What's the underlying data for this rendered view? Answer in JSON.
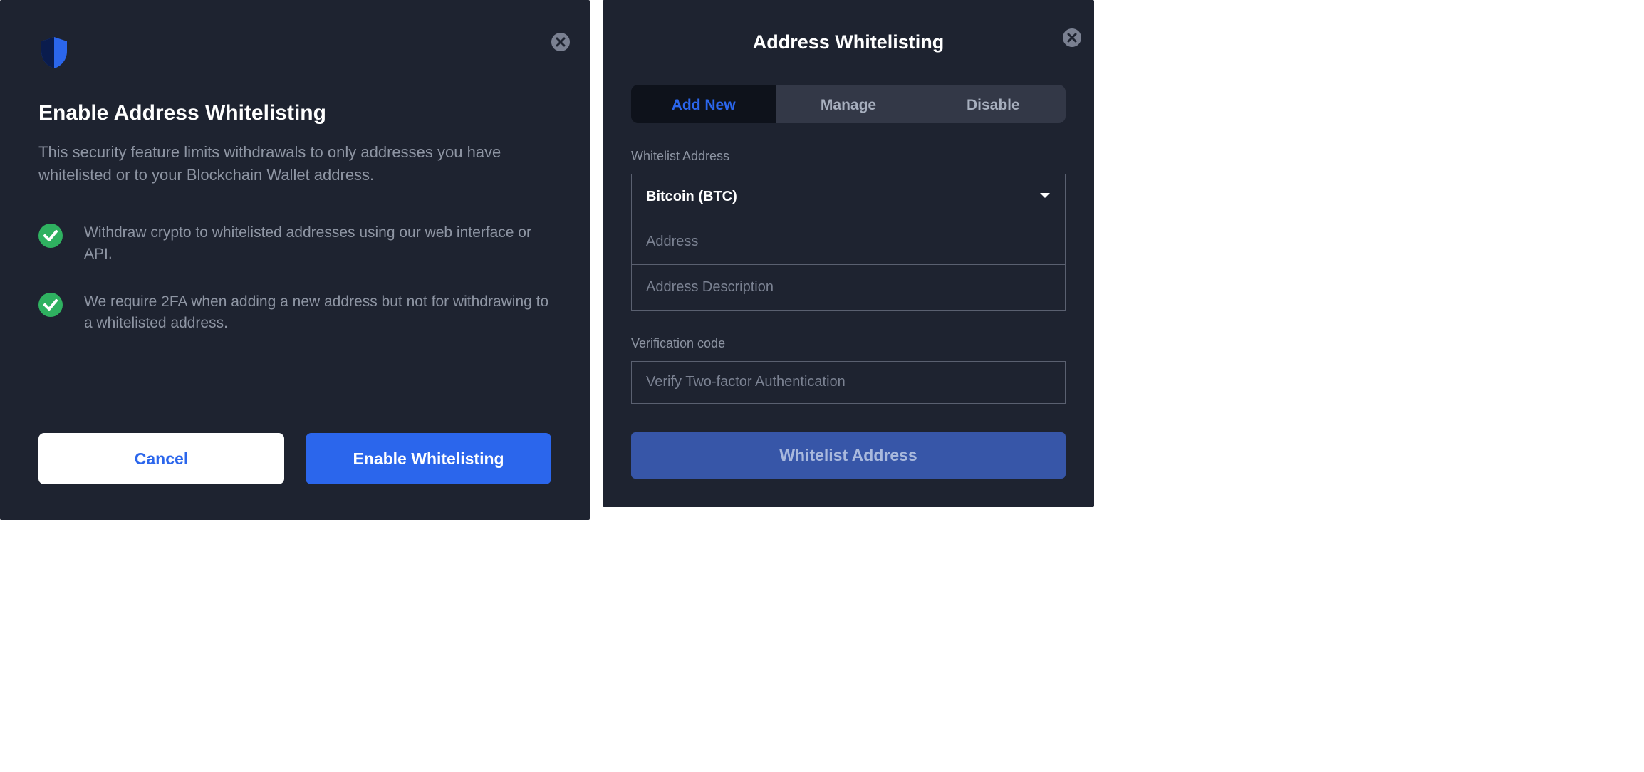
{
  "left": {
    "title": "Enable Address Whitelisting",
    "description": "This security feature limits withdrawals to only addresses you have whitelisted or to your Blockchain Wallet address.",
    "features": [
      "Withdraw crypto to whitelisted addresses using our web interface or API.",
      "We require 2FA when adding a new address but not for withdrawing to a whitelisted address."
    ],
    "cancel_label": "Cancel",
    "enable_label": "Enable Whitelisting"
  },
  "right": {
    "title": "Address Whitelisting",
    "tabs": [
      {
        "label": "Add New",
        "active": true
      },
      {
        "label": "Manage",
        "active": false
      },
      {
        "label": "Disable",
        "active": false
      }
    ],
    "section1_label": "Whitelist Address",
    "currency_selected": "Bitcoin (BTC)",
    "address_placeholder": "Address",
    "description_placeholder": "Address Description",
    "section2_label": "Verification code",
    "verify_placeholder": "Verify Two-factor Authentication",
    "submit_label": "Whitelist Address"
  },
  "icons": {
    "shield": "shield-icon",
    "close": "close-icon",
    "check": "check-circle-icon",
    "chevron": "chevron-down-icon"
  }
}
